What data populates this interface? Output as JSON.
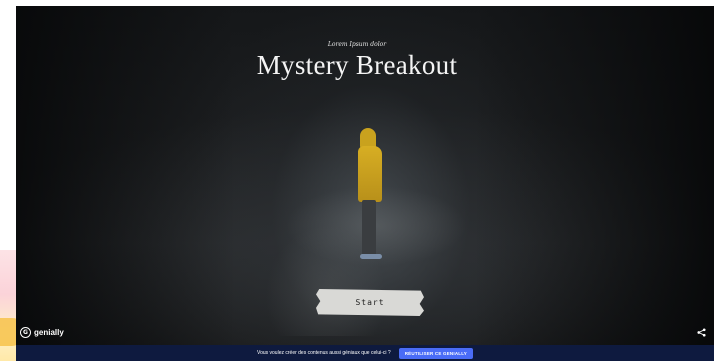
{
  "scene": {
    "subtitle": "Lorem Ipsum dolor",
    "title": "Mystery Breakout",
    "start_button_label": "Start"
  },
  "branding": {
    "logo_text": "genially",
    "logo_icon": "genially-g-icon"
  },
  "controls": {
    "share_icon": "share-icon",
    "share_glyph": "<"
  },
  "promo_bar": {
    "message": "Vous voulez créer des contenus aussi géniaux que celui-ci ?",
    "button_label": "RÉUTILISER CE GENIALLY"
  },
  "colors": {
    "promo_bar_bg": "#0e1a3f",
    "promo_button_bg": "#4a6cf7",
    "jacket_yellow": "#d7ae23"
  }
}
